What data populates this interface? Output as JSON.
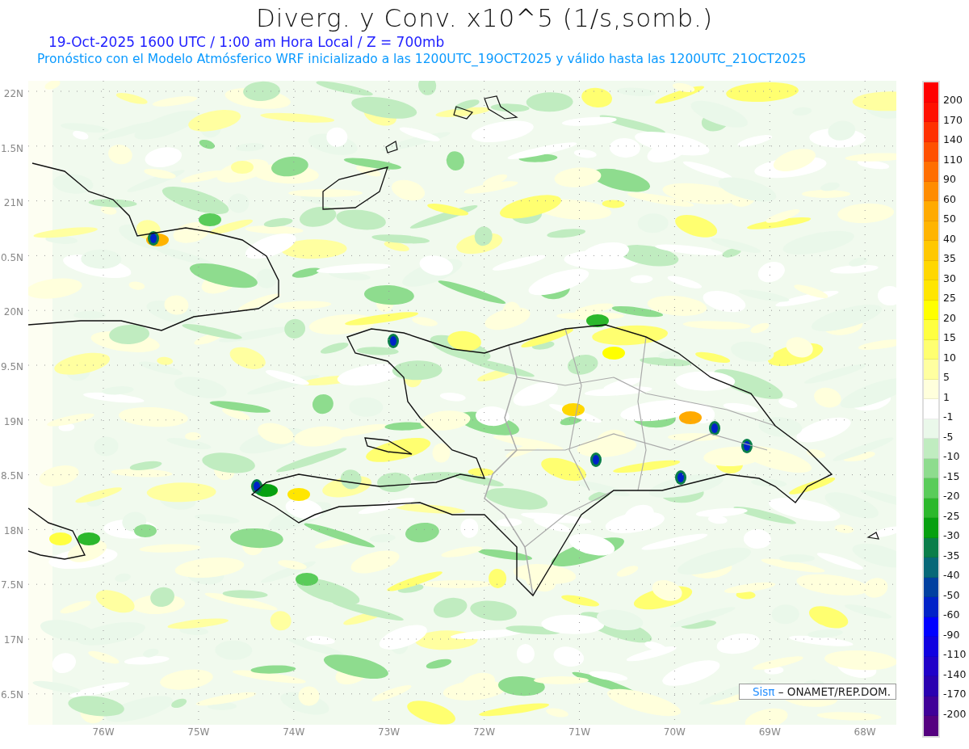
{
  "title": "Diverg. y Conv. x10^5 (1/s,somb.)",
  "subtitle": "19-Oct-2025  1600 UTC / 1:00 am Hora Local / Z = 700mb",
  "forecast_note": "Pronóstico con el Modelo Atmósferico WRF inicializado a las 1200UTC_19OCT2025 y válido hasta las  1200UTC_21OCT2025",
  "map": {
    "lat_labels": [
      "22N",
      "1.5N",
      "21N",
      "0.5N",
      "20N",
      "9.5N",
      "19N",
      "8.5N",
      "18N",
      "7.5N",
      "17N",
      "6.5N"
    ],
    "lon_labels": [
      "76W",
      "75W",
      "74W",
      "73W",
      "72W",
      "71W",
      "70W",
      "69W",
      "68W"
    ],
    "credit": {
      "brand": "Sisπ",
      "text": "– ONAMET/REP.DOM."
    }
  },
  "legend": {
    "bins": [
      {
        "color": "#ff0000"
      },
      {
        "color": "#ff1000"
      },
      {
        "color": "#ff3000"
      },
      {
        "color": "#ff5000"
      },
      {
        "color": "#ff6e00"
      },
      {
        "color": "#ff8c00"
      },
      {
        "color": "#ffaa00"
      },
      {
        "color": "#ffb400"
      },
      {
        "color": "#ffc800"
      },
      {
        "color": "#ffd700"
      },
      {
        "color": "#ffe600"
      },
      {
        "color": "#ffff00"
      },
      {
        "color": "#ffff40"
      },
      {
        "color": "#ffff70"
      },
      {
        "color": "#ffffa0"
      },
      {
        "color": "#ffffdc"
      },
      {
        "color": "#ffffff"
      },
      {
        "color": "#eaf8ea"
      },
      {
        "color": "#c0ecc0"
      },
      {
        "color": "#8edc8e"
      },
      {
        "color": "#5acc5a"
      },
      {
        "color": "#2cb82c"
      },
      {
        "color": "#06a010"
      },
      {
        "color": "#0a7e4a"
      },
      {
        "color": "#066878"
      },
      {
        "color": "#0040a0"
      },
      {
        "color": "#0022c8"
      },
      {
        "color": "#0000ff"
      },
      {
        "color": "#1000e0"
      },
      {
        "color": "#2000c8"
      },
      {
        "color": "#2a00b0"
      },
      {
        "color": "#400098"
      },
      {
        "color": "#550080"
      }
    ],
    "labels": [
      "200",
      "170",
      "140",
      "110",
      "90",
      "60",
      "50",
      "40",
      "35",
      "30",
      "25",
      "20",
      "15",
      "10",
      "5",
      "1",
      "-1",
      "-5",
      "-10",
      "-15",
      "-20",
      "-25",
      "-30",
      "-35",
      "-40",
      "-50",
      "-60",
      "-90",
      "-110",
      "-140",
      "-170",
      "-200"
    ]
  }
}
